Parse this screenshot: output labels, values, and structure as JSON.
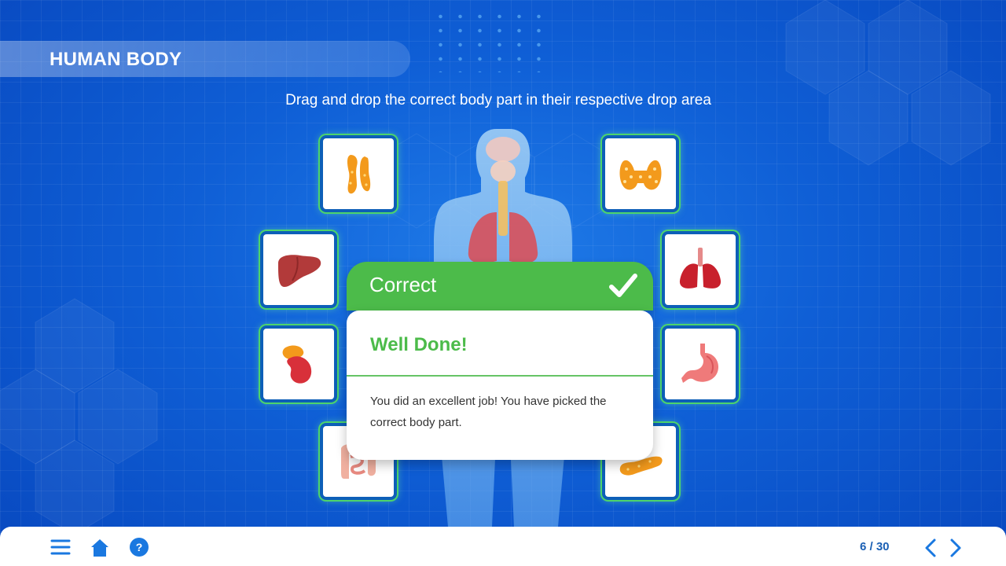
{
  "header": {
    "title": "HUMAN BODY"
  },
  "instruction": "Drag and drop  the correct body part in their respective drop area",
  "organs": [
    {
      "name": "pituitary"
    },
    {
      "name": "thyroid"
    },
    {
      "name": "liver"
    },
    {
      "name": "lungs"
    },
    {
      "name": "kidney-adrenal"
    },
    {
      "name": "stomach"
    },
    {
      "name": "intestines"
    },
    {
      "name": "pancreas"
    }
  ],
  "feedback": {
    "status": "Correct",
    "title": "Well Done!",
    "message": "You did an excellent job! You have picked the correct body part.",
    "icon": "check-icon"
  },
  "footer": {
    "menu_icon": "menu-icon",
    "home_icon": "home-icon",
    "help_icon": "help-icon",
    "page_counter": "6 / 30",
    "prev_icon": "chevron-left-icon",
    "next_icon": "chevron-right-icon"
  },
  "colors": {
    "background": "#0f5fd6",
    "success": "#4cbb4a",
    "card_glow": "#4dd46b",
    "footer_icons": "#1a78e0"
  }
}
